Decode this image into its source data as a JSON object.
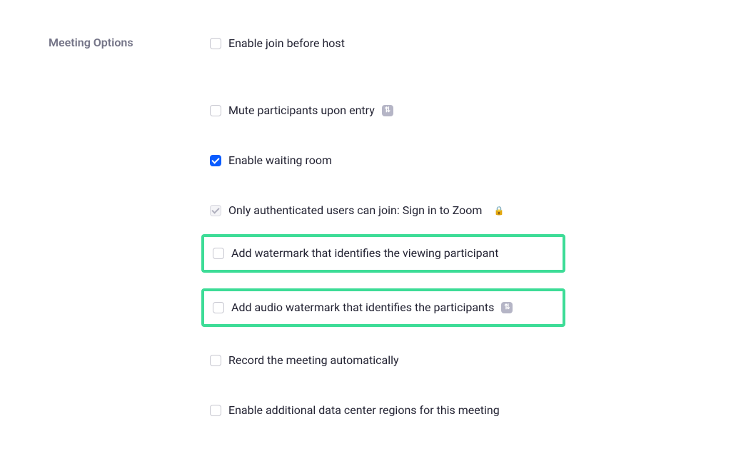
{
  "section_title": "Meeting Options",
  "options": {
    "join_before_host": "Enable join before host",
    "mute_on_entry": "Mute participants upon entry",
    "waiting_room": "Enable waiting room",
    "auth_users": "Only authenticated users can join: Sign in to Zoom",
    "video_watermark": "Add watermark that identifies the viewing participant",
    "audio_watermark": "Add audio watermark that identifies the participants",
    "record_auto": "Record the meeting automatically",
    "data_center": "Enable additional data center regions for this meeting"
  },
  "badge_text": "⇅"
}
